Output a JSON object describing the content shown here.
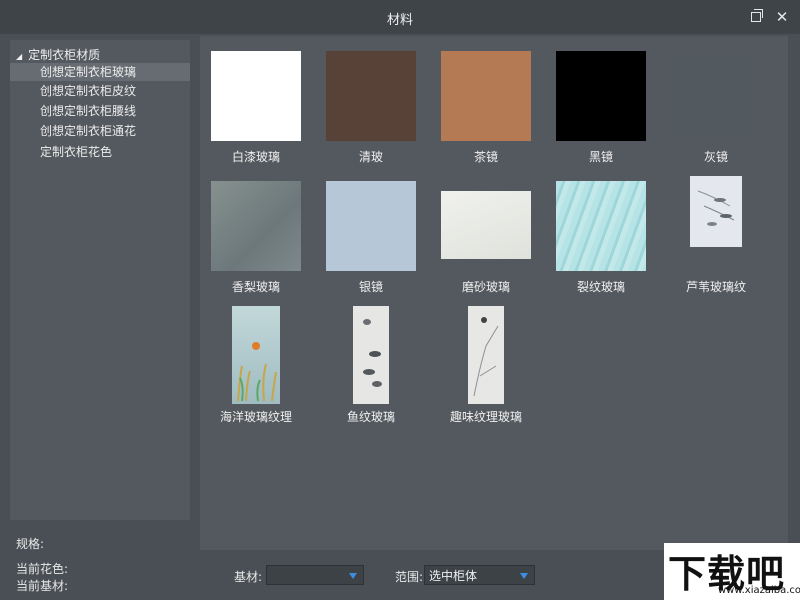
{
  "window": {
    "title": "材料"
  },
  "tree": {
    "root": "定制衣柜材质",
    "items": [
      {
        "label": "创想定制衣柜玻璃",
        "selected": true
      },
      {
        "label": "创想定制衣柜皮纹",
        "selected": false
      },
      {
        "label": "创想定制衣柜腰线",
        "selected": false
      },
      {
        "label": "创想定制衣柜通花",
        "selected": false
      },
      {
        "label": "定制衣柜花色",
        "selected": false
      }
    ]
  },
  "materials": [
    {
      "label": "白漆玻璃",
      "color": "#ffffff"
    },
    {
      "label": "清玻",
      "color": "#584237"
    },
    {
      "label": "茶镜",
      "color": "#b37a54"
    },
    {
      "label": "黑镜",
      "color": "#000000"
    },
    {
      "label": "灰镜",
      "color": "#525a60"
    },
    {
      "label": "香梨玻璃",
      "color": "#798586"
    },
    {
      "label": "银镜",
      "color": "#b6c8d8"
    },
    {
      "label": "磨砂玻璃",
      "color": "#e9ebe6"
    },
    {
      "label": "裂纹玻璃",
      "color": "#a9dde0"
    },
    {
      "label": "芦苇玻璃纹",
      "color": "#e4e8ee"
    },
    {
      "label": "海洋玻璃纹理",
      "color": "#a9c3c6"
    },
    {
      "label": "鱼纹玻璃",
      "color": "#e6e7e4"
    },
    {
      "label": "趣味纹理玻璃",
      "color": "#e7e8e6"
    }
  ],
  "info": {
    "spec_label": "规格:",
    "current_pattern_label": "当前花色:",
    "current_base_label": "当前基材:"
  },
  "controls": {
    "base_label": "基材:",
    "base_value": "",
    "range_label": "范围:",
    "range_value": "选中柜体"
  },
  "watermark": {
    "text": "下载吧",
    "url": "www.xiazaiba.com"
  }
}
